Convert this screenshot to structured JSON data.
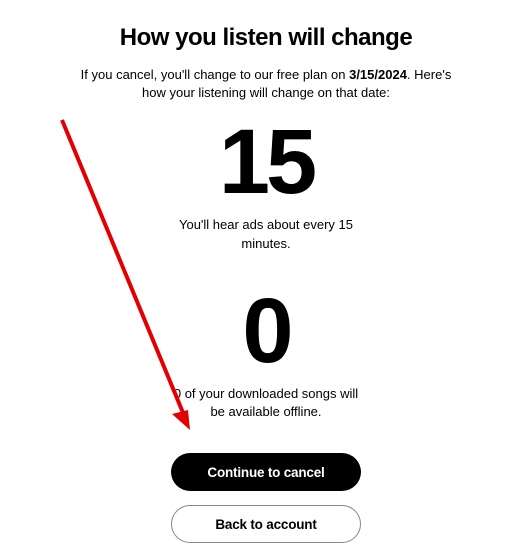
{
  "title": "How you listen will change",
  "subtitle_prefix": "If you cancel, you'll change to our free plan on ",
  "subtitle_date": "3/15/2024",
  "subtitle_suffix": ". Here's how your listening will change on that date:",
  "stats": [
    {
      "number": "15",
      "caption": "You'll hear ads about every 15 minutes."
    },
    {
      "number": "0",
      "caption": "0 of your downloaded songs will be available offline."
    }
  ],
  "buttons": {
    "continue_label": "Continue to cancel",
    "back_label": "Back to account"
  }
}
